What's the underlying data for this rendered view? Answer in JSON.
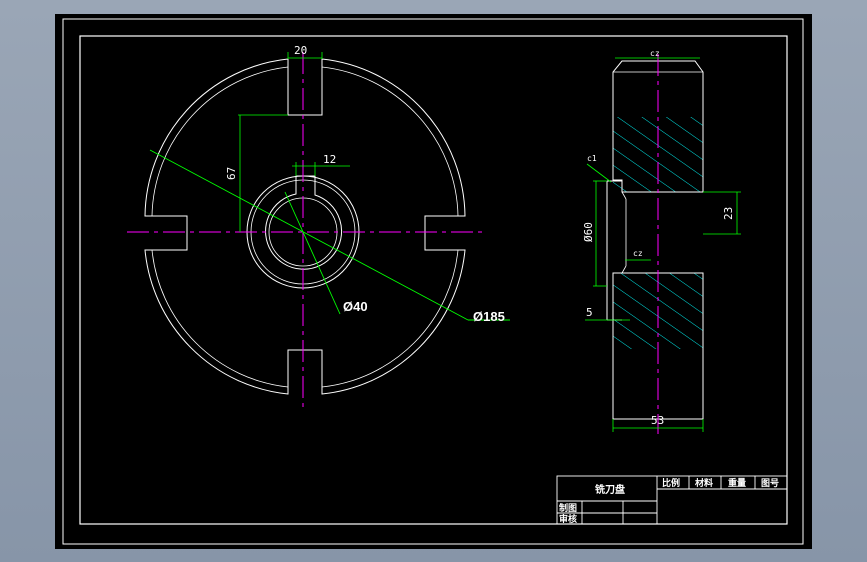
{
  "colors": {
    "background": "#000000",
    "outline": "#ffffff",
    "centerline": "#ff00ff",
    "dimension": "#00ff00",
    "hatch": "#00ffff"
  },
  "front_view": {
    "dims": {
      "keyway_width": "20",
      "slot_depth": "67",
      "hub_key": "12",
      "bore_diameter": "Ø40",
      "outer_diameter": "Ø185"
    }
  },
  "side_view": {
    "dims": {
      "top_chamfer": "cz",
      "left_chamfer": "c1",
      "inner_chamfer": "cz",
      "hub_diameter": "Ø60",
      "step": "5",
      "bore_right": "23",
      "width": "53"
    }
  },
  "title_block": {
    "part_name": "铣刀盘",
    "headers": [
      "比例",
      "材料",
      "重量",
      "图号"
    ],
    "drawn_label": "制图",
    "checked_label": "审核"
  }
}
